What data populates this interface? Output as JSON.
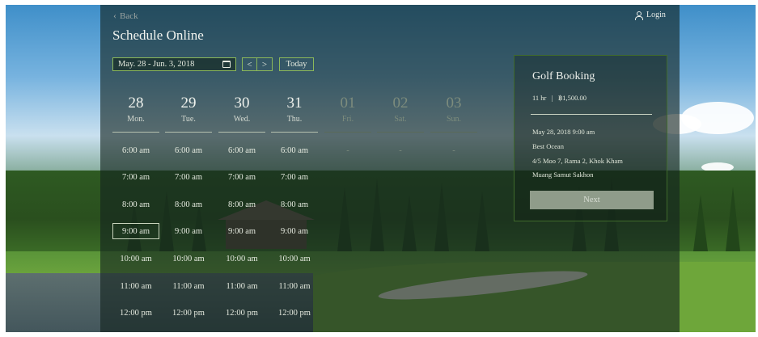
{
  "header": {
    "back_label": "Back",
    "login_label": "Login",
    "title": "Schedule Online"
  },
  "toolbar": {
    "date_range": "May. 28 - Jun. 3, 2018",
    "prev_label": "<",
    "next_label": ">",
    "today_label": "Today"
  },
  "days": [
    {
      "num": "28",
      "name": "Mon.",
      "enabled": true
    },
    {
      "num": "29",
      "name": "Tue.",
      "enabled": true
    },
    {
      "num": "30",
      "name": "Wed.",
      "enabled": true
    },
    {
      "num": "31",
      "name": "Thu.",
      "enabled": true
    },
    {
      "num": "01",
      "name": "Fri.",
      "enabled": false
    },
    {
      "num": "02",
      "name": "Sat.",
      "enabled": false
    },
    {
      "num": "03",
      "name": "Sun.",
      "enabled": false
    }
  ],
  "times": [
    "6:00 am",
    "7:00 am",
    "8:00 am",
    "9:00 am",
    "10:00 am",
    "11:00 am",
    "12:00 pm"
  ],
  "selected_slot": {
    "day": "28",
    "time": "9:00 am"
  },
  "unavailable_marker": "-",
  "booking": {
    "title": "Golf Booking",
    "duration": "11 hr",
    "separator": "|",
    "price": "฿1,500.00",
    "datetime": "May 28, 2018 9:00 am",
    "venue": "Best Ocean",
    "address_line1": "4/5 Moo 7, Rama 2, Khok Kham",
    "address_line2": "Muang Samut Sakhon",
    "next_label": "Next"
  },
  "colors": {
    "accent_border": "#8bb85a",
    "overlay": "#142320"
  }
}
